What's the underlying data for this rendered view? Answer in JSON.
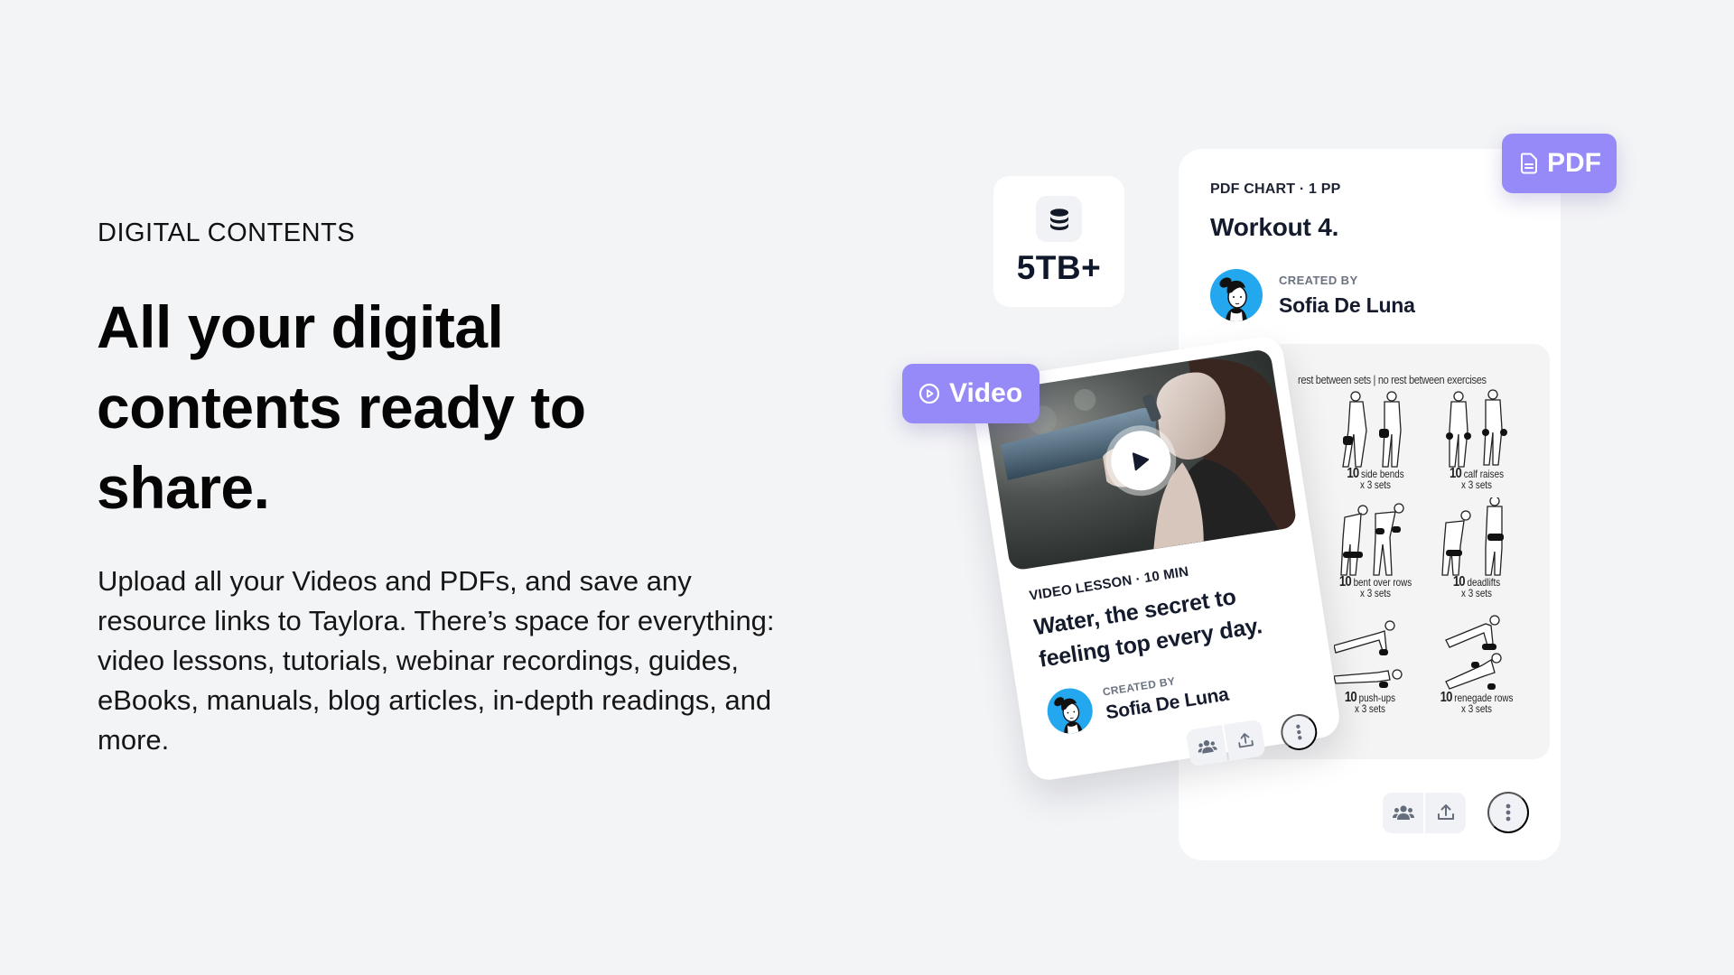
{
  "section": {
    "eyebrow": "DIGITAL CONTENTS",
    "headline_lines": [
      "All your digital",
      "contents ready to",
      "share."
    ],
    "body": "Upload all your Videos and PDFs, and save any resource links to Taylora. There’s space for everything: video lessons, tutorials, webinar recordings, guides, eBooks, manuals, blog articles, in-depth readings, and more."
  },
  "stat": {
    "icon": "database-icon",
    "value": "5TB+"
  },
  "badges": {
    "pdf": {
      "label": "PDF",
      "icon": "document-icon"
    },
    "video": {
      "label": "Video",
      "icon": "play-circle-icon"
    }
  },
  "pdf_card": {
    "meta": "PDF CHART · 1 PP",
    "title": "Workout 4.",
    "creator_label": "CREATED BY",
    "creator_name": "Sofia De Luna",
    "preview": {
      "rest_line": "rest between sets  |  no rest between exercises",
      "exercises": [
        {
          "count": "10",
          "name": "side bends",
          "sets": "x 3 sets"
        },
        {
          "count": "10",
          "name": "calf raises",
          "sets": "x 3 sets"
        },
        {
          "count": "10",
          "name": "bent over rows",
          "sets": "x 3 sets"
        },
        {
          "count": "10",
          "name": "deadlifts",
          "sets": "x 3 sets"
        },
        {
          "count": "10",
          "name": "push-ups",
          "sets": "x 3 sets"
        },
        {
          "count": "10",
          "name": "renegade rows",
          "sets": "x 3 sets"
        }
      ]
    },
    "actions": [
      "share-with-group",
      "upload",
      "more-options"
    ]
  },
  "video_card": {
    "meta": "VIDEO LESSON · 10 MIN",
    "title": "Water, the secret to feeling top every day.",
    "creator_label": "CREATED BY",
    "creator_name": "Sofia De Luna",
    "actions": [
      "share-with-group",
      "upload",
      "more-options"
    ]
  },
  "colors": {
    "background": "#F3F4F6",
    "accent": "#958AF8",
    "card": "#FFFFFF",
    "avatar_bg": "#23A7EF",
    "text_dark": "#141B2D",
    "text_muted": "#6B7280",
    "button_bg": "#F1F2F5"
  }
}
